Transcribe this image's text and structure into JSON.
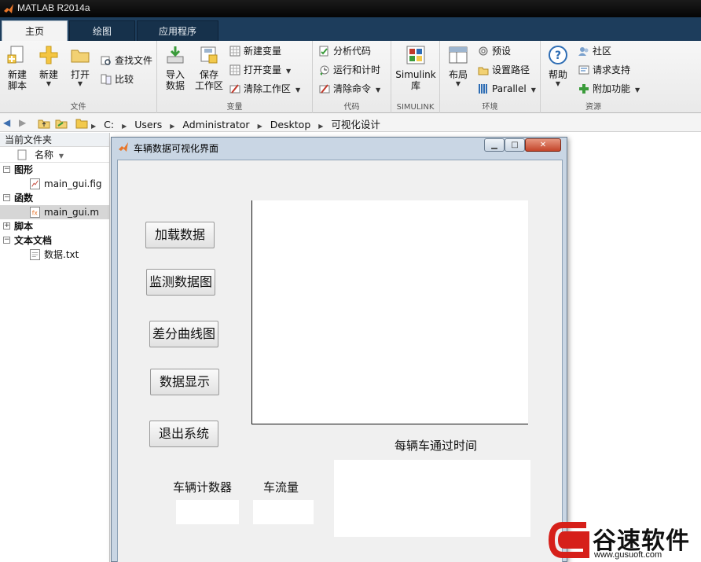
{
  "app": {
    "title": "MATLAB R2014a"
  },
  "tabs": [
    {
      "label": "主页"
    },
    {
      "label": "绘图"
    },
    {
      "label": "应用程序"
    }
  ],
  "ribbon": {
    "file": {
      "label": "文件",
      "new_script": "新建\n脚本",
      "new": "新建",
      "open": "打开",
      "find_files": "查找文件",
      "compare": "比较"
    },
    "variable": {
      "label": "变量",
      "import_data": "导入\n数据",
      "save_workspace": "保存\n工作区",
      "new_variable": "新建变量",
      "open_variable": "打开变量",
      "clear_workspace": "清除工作区"
    },
    "code": {
      "label": "代码",
      "analyze_code": "分析代码",
      "run_and_time": "运行和计时",
      "clear_commands": "清除命令"
    },
    "simulink": {
      "label": "SIMULINK",
      "library": "Simulink\n库"
    },
    "environment": {
      "label": "环境",
      "layout": "布局",
      "preferences": "预设",
      "set_path": "设置路径",
      "parallel": "Parallel"
    },
    "resources": {
      "label": "资源",
      "help": "帮助",
      "community": "社区",
      "request_support": "请求支持",
      "add_ons": "附加功能"
    }
  },
  "address": {
    "path": [
      "C:",
      "Users",
      "Administrator",
      "Desktop",
      "可视化设计"
    ]
  },
  "folder_panel": {
    "title": "当前文件夹",
    "column_name": "名称",
    "tree": [
      {
        "label": "图形",
        "children": [
          "main_gui.fig"
        ]
      },
      {
        "label": "函数",
        "children": [
          "main_gui.m"
        ]
      },
      {
        "label": "脚本",
        "children": []
      },
      {
        "label": "文本文档",
        "children": [
          "数据.txt"
        ]
      }
    ]
  },
  "gui_window": {
    "title": "车辆数据可视化界面",
    "buttons": {
      "load_data": "加载数据",
      "monitor_plot": "监测数据图",
      "diff_curve": "差分曲线图",
      "data_display": "数据显示",
      "exit_system": "退出系统"
    },
    "labels": {
      "pass_time": "每辆车通过时间",
      "vehicle_counter": "车辆计数器",
      "traffic_flow": "车流量"
    }
  },
  "watermark": {
    "text": "谷速软件",
    "url": "www.gusuoft.com"
  }
}
